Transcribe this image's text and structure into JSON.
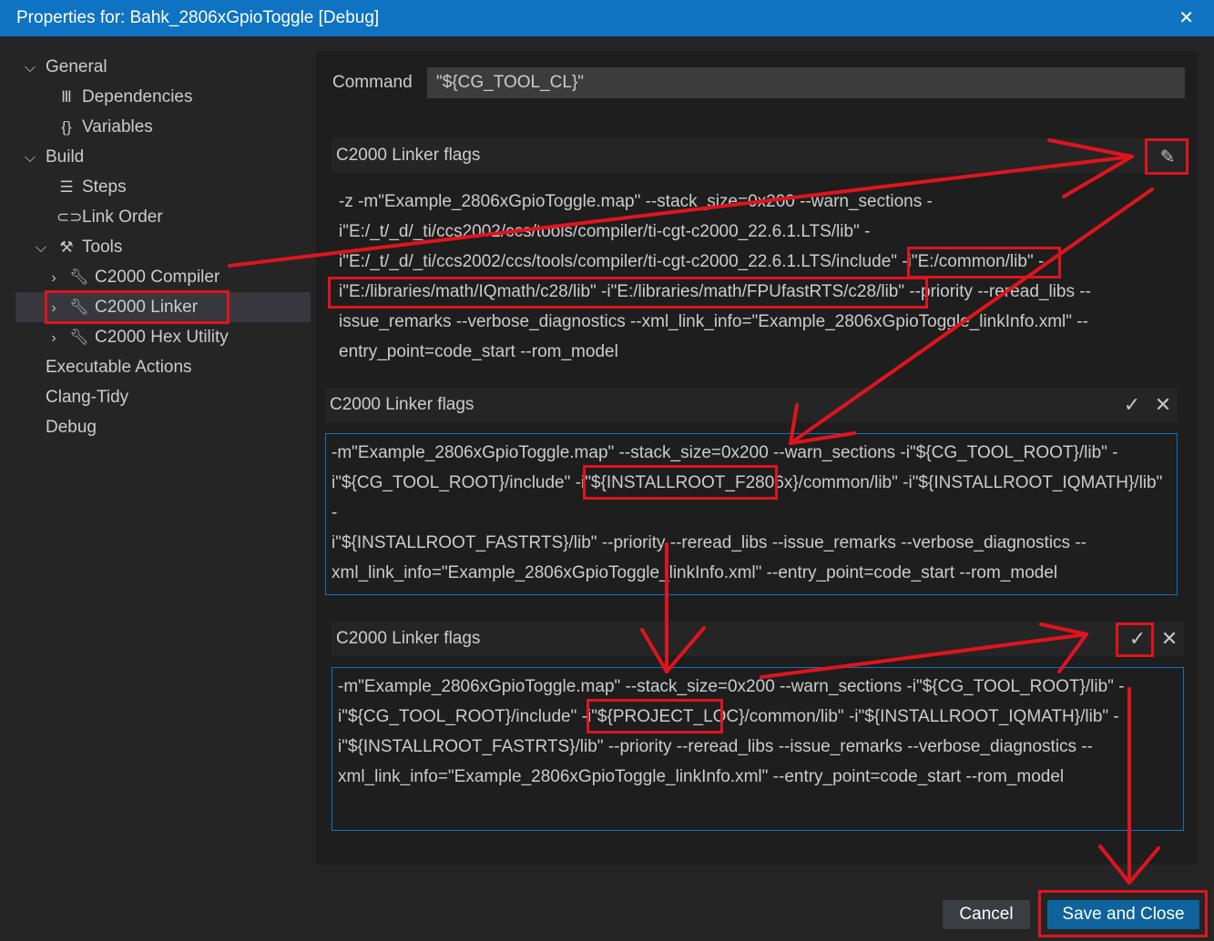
{
  "window": {
    "title": "Properties for: Bahk_2806xGpioToggle [Debug]"
  },
  "sidebar": {
    "general": "General",
    "dependencies": "Dependencies",
    "variables": "Variables",
    "build": "Build",
    "steps": "Steps",
    "link_order": "Link Order",
    "tools": "Tools",
    "compiler": "C2000 Compiler",
    "linker": "C2000 Linker",
    "hex_utility": "C2000 Hex Utility",
    "executable_actions": "Executable Actions",
    "clang_tidy": "Clang-Tidy",
    "debug": "Debug"
  },
  "command": {
    "label": "Command",
    "value": "\"${CG_TOOL_CL}\""
  },
  "flags_view": {
    "title": "C2000 Linker flags",
    "lines": [
      "-z -m\"Example_2806xGpioToggle.map\" --stack_size=0x200 --warn_sections -",
      "i\"E:/_t/_d/_ti/ccs2002/ccs/tools/compiler/ti-cgt-c2000_22.6.1.LTS/lib\" -",
      "i\"E:/_t/_d/_ti/ccs2002/ccs/tools/compiler/ti-cgt-c2000_22.6.1.LTS/include\" -i\"E:/common/lib\" -",
      "i\"E:/libraries/math/IQmath/c28/lib\" -i\"E:/libraries/math/FPUfastRTS/c28/lib\" --priority --reread_libs --",
      "issue_remarks --verbose_diagnostics --xml_link_info=\"Example_2806xGpioToggle_linkInfo.xml\" --",
      "entry_point=code_start --rom_model"
    ]
  },
  "editor1": {
    "title": "C2000 Linker flags",
    "lines": [
      "-m\"Example_2806xGpioToggle.map\" --stack_size=0x200 --warn_sections -i\"${CG_TOOL_ROOT}/lib\" -",
      "i\"${CG_TOOL_ROOT}/include\" -i\"${INSTALLROOT_F2806x}/common/lib\" -i\"${INSTALLROOT_IQMATH}/lib\" -",
      "i\"${INSTALLROOT_FASTRTS}/lib\" --priority --reread_libs --issue_remarks --verbose_diagnostics --",
      "xml_link_info=\"Example_2806xGpioToggle_linkInfo.xml\" --entry_point=code_start --rom_model"
    ]
  },
  "editor2": {
    "title": "C2000 Linker flags",
    "lines": [
      "-m\"Example_2806xGpioToggle.map\" --stack_size=0x200 --warn_sections -i\"${CG_TOOL_ROOT}/lib\" -",
      "i\"${CG_TOOL_ROOT}/include\" -i\"${PROJECT_LOC}/common/lib\" -i\"${INSTALLROOT_IQMATH}/lib\" -",
      "i\"${INSTALLROOT_FASTRTS}/lib\" --priority --reread_libs --issue_remarks --verbose_diagnostics --",
      "xml_link_info=\"Example_2806xGpioToggle_linkInfo.xml\" --entry_point=code_start --rom_model"
    ]
  },
  "buttons": {
    "cancel": "Cancel",
    "save": "Save and Close"
  },
  "icons": {
    "close": "close-icon",
    "chevron_down": "chevron-down-icon",
    "chevron_right": "chevron-right-icon",
    "library": "library-icon",
    "braces": "braces-icon",
    "list": "list-icon",
    "link": "link-icon",
    "tools": "tools-icon",
    "wrench": "wrench-icon",
    "pencil": "pencil-icon",
    "check": "check-icon"
  },
  "colors": {
    "accent": "#0e73c2",
    "annotation": "#e0141e",
    "background": "#252526"
  }
}
